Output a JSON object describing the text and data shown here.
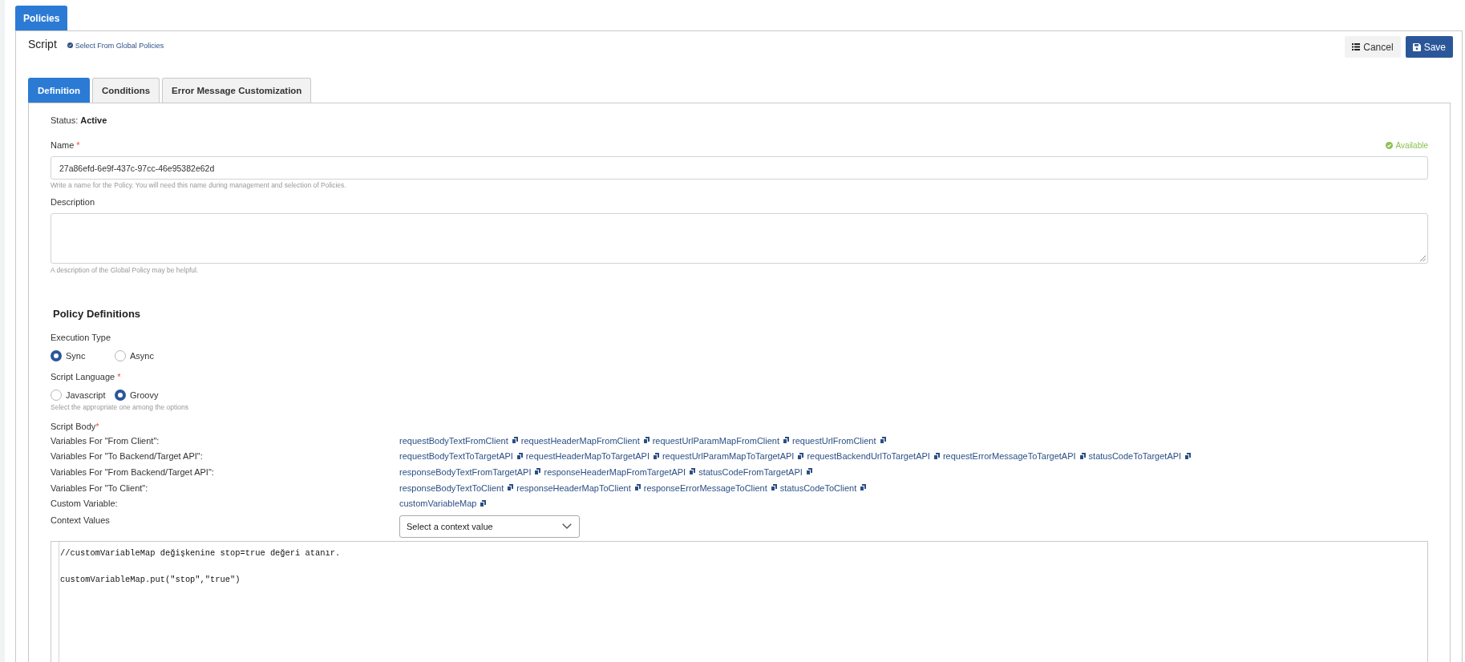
{
  "top_tabs": [
    {
      "label": "Policies",
      "selected": true
    }
  ],
  "panel": {
    "title": "Script",
    "global_link": "Select From Global Policies",
    "buttons": [
      {
        "kind": "cancel",
        "label": "Cancel"
      },
      {
        "kind": "save",
        "label": "Save"
      }
    ]
  },
  "tabs": [
    {
      "label": "Definition",
      "selected": true
    },
    {
      "label": "Conditions",
      "selected": false
    },
    {
      "label": "Error Message Customization",
      "selected": false
    }
  ],
  "status": {
    "label": "Status:",
    "value": "Active"
  },
  "name_field": {
    "label": "Name",
    "required_mark": "*",
    "availability": "Available",
    "value": "27a86efd-6e9f-437c-97cc-46e95382e62d",
    "help": "Write a name for the Policy. You will need this name during management and selection of Policies."
  },
  "description_field": {
    "label": "Description",
    "help": "A description of the Global Policy may be helpful."
  },
  "policy_definitions": {
    "heading": "Policy Definitions",
    "execution_type": {
      "label": "Execution Type",
      "options": [
        {
          "label": "Sync",
          "selected": true
        },
        {
          "label": "Async",
          "selected": false
        }
      ]
    },
    "script_language": {
      "label": "Script Language",
      "required_mark": "*",
      "options": [
        {
          "label": "Javascript",
          "selected": false
        },
        {
          "label": "Groovy",
          "selected": true
        }
      ],
      "help": "Select the appropriate one among the options"
    },
    "script_body": {
      "label": "Script Body",
      "required_mark": "*"
    },
    "variable_groups": [
      {
        "label": "Variables For \"From Client\":",
        "variables": [
          "requestBodyTextFromClient",
          "requestHeaderMapFromClient",
          "requestUrlParamMapFromClient",
          "requestUrlFromClient"
        ]
      },
      {
        "label": "Variables For \"To Backend/Target API\":",
        "variables": [
          "requestBodyTextToTargetAPI",
          "requestHeaderMapToTargetAPI",
          "requestUrlParamMapToTargetAPI",
          "requestBackendUrlToTargetAPI",
          "requestErrorMessageToTargetAPI",
          "statusCodeToTargetAPI"
        ]
      },
      {
        "label": "Variables For \"From Backend/Target API\":",
        "variables": [
          "responseBodyTextFromTargetAPI",
          "responseHeaderMapFromTargetAPI",
          "statusCodeFromTargetAPI"
        ]
      },
      {
        "label": "Variables For \"To Client\":",
        "variables": [
          "responseBodyTextToClient",
          "responseHeaderMapToClient",
          "responseErrorMessageToClient",
          "statusCodeToClient"
        ]
      },
      {
        "label": "Custom Variable:",
        "variables": [
          "customVariableMap"
        ]
      }
    ],
    "context_values": {
      "label": "Context Values",
      "placeholder": "Select a context value"
    },
    "code": "//customVariableMap değişkenine stop=true değeri atanır.\n\ncustomVariableMap.put(\"stop\",\"true\")"
  }
}
